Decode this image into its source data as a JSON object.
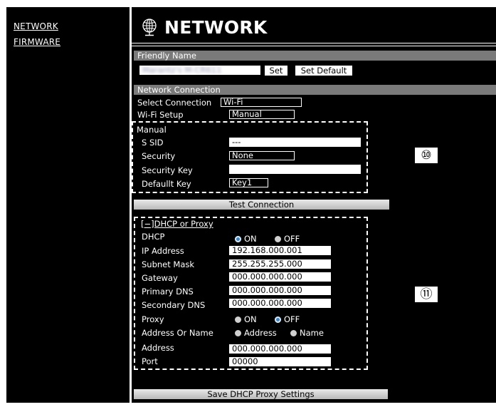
{
  "sidebar": {
    "items": [
      {
        "label": "NETWORK"
      },
      {
        "label": "FIRMWARE"
      }
    ]
  },
  "header": {
    "title": "NETWORK",
    "icon": "globe-icon"
  },
  "friendly_name": {
    "section_label": "Friendly Name",
    "value": "Marantz's M-CR611",
    "set_label": "Set",
    "set_default_label": "Set Default"
  },
  "network_connection": {
    "section_label": "Network Connection",
    "select_connection_label": "Select Connection",
    "select_connection_value": "Wi-Fi",
    "wifi_setup_label": "Wi-Fi Setup",
    "wifi_setup_value": "Manual",
    "manual": {
      "heading": "Manual",
      "ssid_label": "S SID",
      "ssid_value": "---",
      "security_label": "Security",
      "security_value": "None",
      "security_key_label": "Security Key",
      "security_key_value": "",
      "default_key_label": "Defaullt Key",
      "default_key_value": "Key1"
    },
    "test_connection_label": "Test Connection"
  },
  "dhcp_proxy": {
    "heading": "[−]DHCP or Proxy",
    "dhcp_label": "DHCP",
    "dhcp_on_label": "ON",
    "dhcp_off_label": "OFF",
    "dhcp_selected": "ON",
    "ip_address_label": "IP Address",
    "ip_address_value": "192.168.000.001",
    "subnet_mask_label": "Subnet Mask",
    "subnet_mask_value": "255.255.255.000",
    "gateway_label": "Gateway",
    "gateway_value": "000.000.000.000",
    "primary_dns_label": "Primary DNS",
    "primary_dns_value": "000.000.000.000",
    "secondary_dns_label": "Secondary DNS",
    "secondary_dns_value": "000.000.000.000",
    "proxy_label": "Proxy",
    "proxy_on_label": "ON",
    "proxy_off_label": "OFF",
    "proxy_selected": "OFF",
    "address_or_name_label": "Address Or Name",
    "address_option_label": "Address",
    "name_option_label": "Name",
    "address_label": "Address",
    "address_value": "000.000.000.000",
    "port_label": "Port",
    "port_value": "00000",
    "save_label": "Save DHCP Proxy Settings"
  },
  "callouts": {
    "manual_callout": "⑩",
    "dhcp_callout": "⑪"
  },
  "colors": {
    "background": "#000000",
    "section_bar": "#7a7a7a",
    "radio_selected": "#3d86c6"
  }
}
